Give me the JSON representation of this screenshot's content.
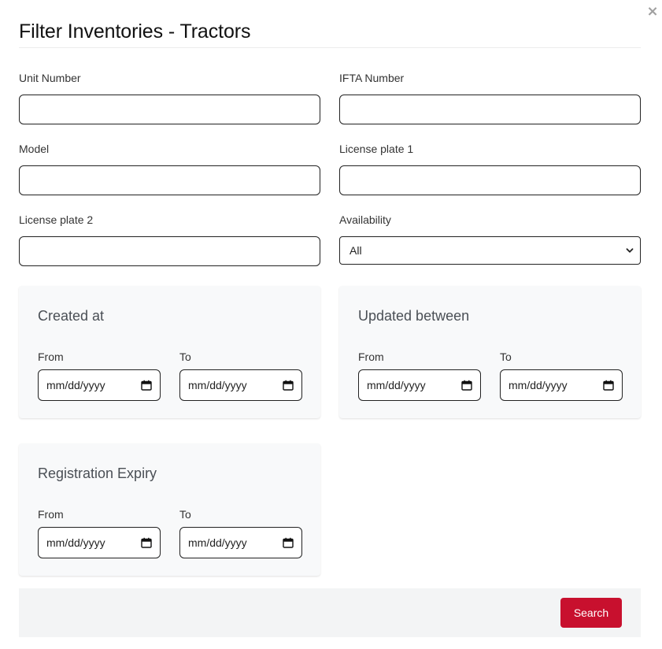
{
  "dialog": {
    "title": "Filter Inventories - Tractors",
    "close_glyph": "×"
  },
  "fields": {
    "unit_number": {
      "label": "Unit Number",
      "value": ""
    },
    "ifta_number": {
      "label": "IFTA Number",
      "value": ""
    },
    "model": {
      "label": "Model",
      "value": ""
    },
    "license_plate_1": {
      "label": "License plate 1",
      "value": ""
    },
    "license_plate_2": {
      "label": "License plate 2",
      "value": ""
    },
    "availability": {
      "label": "Availability",
      "selected": "All"
    }
  },
  "date_sections": {
    "created_at": {
      "title": "Created at",
      "from_label": "From",
      "from_placeholder": "mm/dd/yyyy",
      "to_label": "To",
      "to_placeholder": "mm/dd/yyyy"
    },
    "updated_between": {
      "title": "Updated between",
      "from_label": "From",
      "from_placeholder": "mm/dd/yyyy",
      "to_label": "To",
      "to_placeholder": "mm/dd/yyyy"
    },
    "registration_expiry": {
      "title": "Registration Expiry",
      "from_label": "From",
      "from_placeholder": "mm/dd/yyyy",
      "to_label": "To",
      "to_placeholder": "mm/dd/yyyy"
    }
  },
  "footer": {
    "search_label": "Search"
  },
  "colors": {
    "primary_button": "#c8102e",
    "card_background": "#f8f9fa",
    "footer_background": "#f3f4f5"
  },
  "icons": {
    "close": "close-icon",
    "calendar": "calendar-icon",
    "select_arrow": "chevron-down-icon"
  }
}
